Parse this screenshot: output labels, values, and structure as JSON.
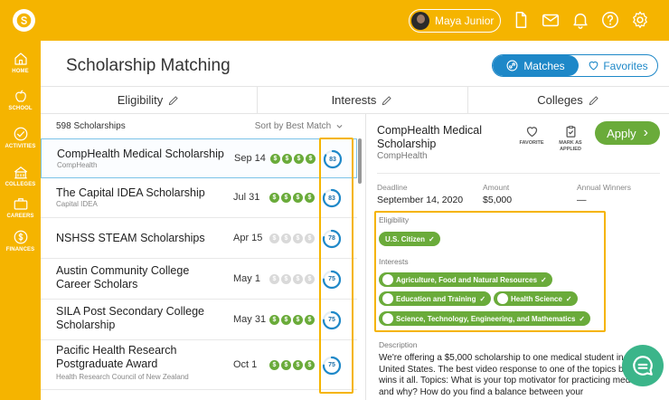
{
  "topbar": {
    "user_name": "Maya Junior"
  },
  "sidebar": {
    "items": [
      {
        "label": "HOME"
      },
      {
        "label": "SCHOOL"
      },
      {
        "label": "ACTIVITIES"
      },
      {
        "label": "COLLEGES"
      },
      {
        "label": "CAREERS"
      },
      {
        "label": "FINANCES"
      }
    ]
  },
  "page": {
    "title": "Scholarship Matching"
  },
  "toggle": {
    "matches": "Matches",
    "favorites": "Favorites"
  },
  "tabs": [
    {
      "label": "Eligibility"
    },
    {
      "label": "Interests"
    },
    {
      "label": "Colleges"
    }
  ],
  "list": {
    "count": "598 Scholarships",
    "sort": "Sort by Best Match",
    "items": [
      {
        "name": "CompHealth Medical Scholarship",
        "sub": "CompHealth",
        "date": "Sep 14",
        "cost_level": 4,
        "score": "83",
        "score_value": 83
      },
      {
        "name": "The Capital IDEA Scholarship",
        "sub": "Capital IDEA",
        "date": "Jul 31",
        "cost_level": 4,
        "score": "83",
        "score_value": 83
      },
      {
        "name": "NSHSS STEAM Scholarships",
        "sub": "",
        "date": "Apr 15",
        "cost_level": 0,
        "score": "78",
        "score_value": 78
      },
      {
        "name": "Austin Community College Career Scholars",
        "sub": "",
        "date": "May 1",
        "cost_level": 0,
        "score": "75",
        "score_value": 75
      },
      {
        "name": "SILA Post Secondary College Scholarship",
        "sub": "",
        "date": "May 31",
        "cost_level": 4,
        "score": "75",
        "score_value": 75
      },
      {
        "name": "Pacific Health Research Postgraduate Award",
        "sub": "Health Research Council of New Zealand",
        "date": "Oct 1",
        "cost_level": 4,
        "score": "75",
        "score_value": 75
      }
    ],
    "coin_symbol": "$"
  },
  "detail": {
    "name": "CompHealth Medical Scholarship",
    "org": "CompHealth",
    "favorite_label": "FAVORITE",
    "mark_label_1": "MARK AS",
    "mark_label_2": "APPLIED",
    "apply_label": "Apply",
    "apply_chevron": "›",
    "deadline_label": "Deadline",
    "deadline": "September 14, 2020",
    "amount_label": "Amount",
    "amount": "$5,000",
    "winners_label": "Annual Winners",
    "winners": "—",
    "eligibility_label": "Eligibility",
    "eligibility_tag": "U.S. Citizen",
    "interests_label": "Interests",
    "interest_tags": [
      "Agriculture, Food and Natural Resources",
      "Education and Training",
      "Health Science",
      "Science, Technology, Engineering, and Mathematics"
    ],
    "description_label": "Description",
    "description": "We're offering a $5,000 scholarship to one medical student in the United States. The best video response to one of the topics below wins it all. Topics: What is your top motivator for practicing medicine and why? How do you find a balance between your"
  },
  "colors": {
    "brand": "#f5b400",
    "accent": "#1e88c8",
    "green": "#6aab3a",
    "chat": "#3bb58a"
  }
}
